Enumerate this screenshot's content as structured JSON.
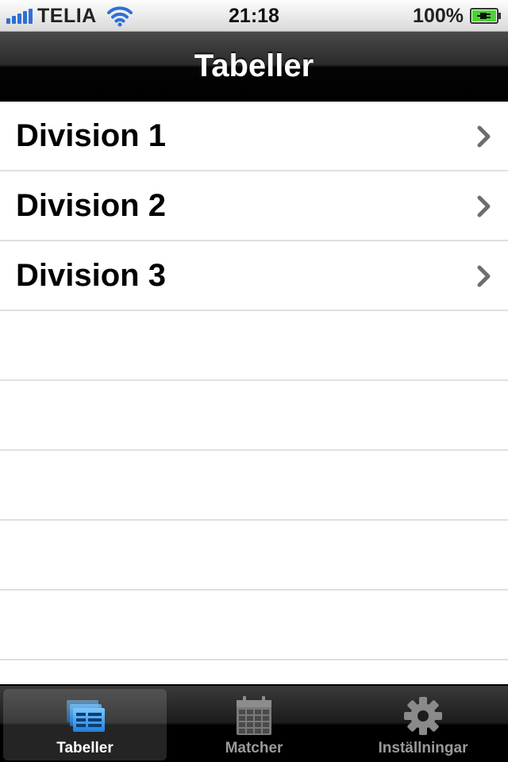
{
  "status_bar": {
    "carrier": "TELIA",
    "time": "21:18",
    "battery_percent": "100%",
    "signal_bars": 5,
    "signal_icon": "signal-bars-icon",
    "wifi_icon": "wifi-icon",
    "battery_icon": "battery-charging-icon",
    "signal_color": "#2f6fd6",
    "battery_color": "#4cd137"
  },
  "nav": {
    "title": "Tabeller"
  },
  "table": {
    "rows": [
      {
        "label": "Division 1",
        "accessory": "chevron-right-icon"
      },
      {
        "label": "Division 2",
        "accessory": "chevron-right-icon"
      },
      {
        "label": "Division 3",
        "accessory": "chevron-right-icon"
      }
    ],
    "empty_rows": 5
  },
  "tab_bar": {
    "selected_index": 0,
    "items": [
      {
        "label": "Tabeller",
        "icon": "tables-icon",
        "selected": true
      },
      {
        "label": "Matcher",
        "icon": "calendar-icon",
        "selected": false
      },
      {
        "label": "Inställningar",
        "icon": "gear-icon",
        "selected": false
      }
    ],
    "active_icon_color": "#3a9ee8"
  }
}
